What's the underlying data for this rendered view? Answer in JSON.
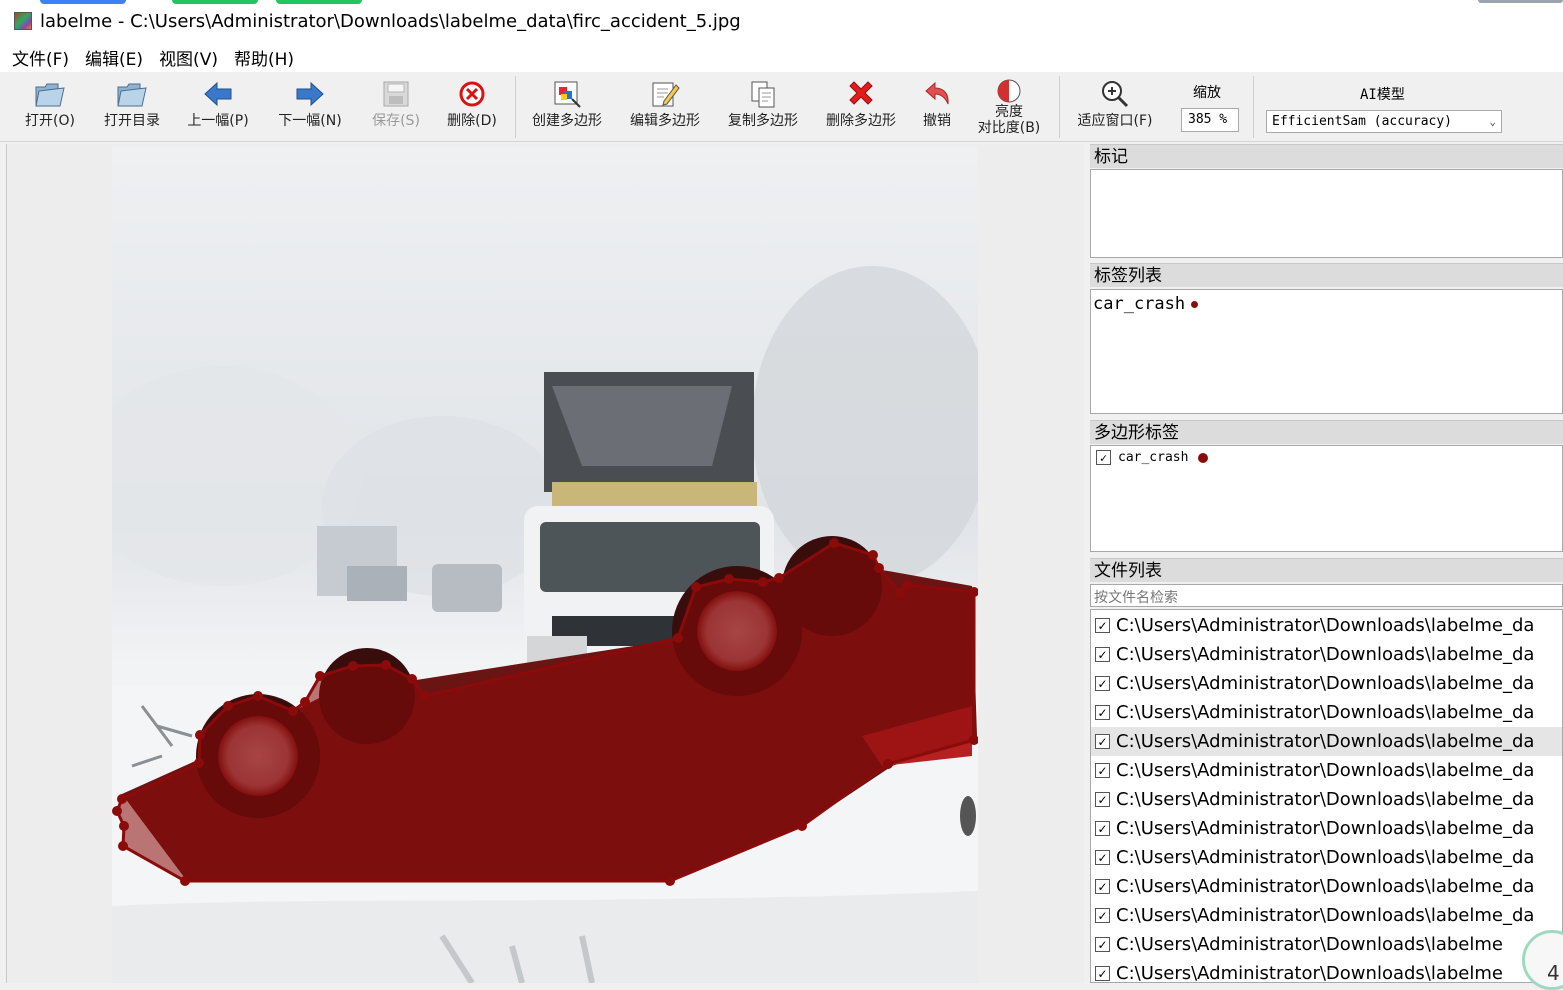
{
  "window": {
    "title": "labelme - C:\\Users\\Administrator\\Downloads\\labelme_data\\firc_accident_5.jpg"
  },
  "menu": [
    "文件(F)",
    "编辑(E)",
    "视图(V)",
    "帮助(H)"
  ],
  "toolbar": {
    "open": "打开(O)",
    "open_dir": "打开目录",
    "prev": "上一幅(P)",
    "next": "下一幅(N)",
    "save": "保存(S)",
    "delete": "删除(D)",
    "create_polygon": "创建多边形",
    "edit_polygon": "编辑多边形",
    "copy_polygon": "复制多边形",
    "delete_polygon": "删除多边形",
    "undo": "撤销",
    "brightness_line1": "亮度",
    "brightness_line2": "对比度(B)",
    "fit_window": "适应窗口(F)",
    "zoom_label": "缩放",
    "zoom_value": "385 %",
    "ai_label": "AI模型",
    "ai_model": "EfficientSam (accuracy)"
  },
  "panels": {
    "flags_title": "标记",
    "label_list_title": "标签列表",
    "label_list": [
      {
        "label": "car_crash",
        "color": "#8b0a0a"
      }
    ],
    "polygon_labels_title": "多边形标签",
    "polygon_labels": [
      {
        "label": "car_crash",
        "checked": true,
        "color": "#8b0a0a"
      }
    ],
    "file_list_title": "文件列表",
    "search_placeholder": "按文件名检索",
    "files": [
      {
        "path": "C:\\Users\\Administrator\\Downloads\\labelme_da",
        "checked": true,
        "selected": false
      },
      {
        "path": "C:\\Users\\Administrator\\Downloads\\labelme_da",
        "checked": true,
        "selected": false
      },
      {
        "path": "C:\\Users\\Administrator\\Downloads\\labelme_da",
        "checked": true,
        "selected": false
      },
      {
        "path": "C:\\Users\\Administrator\\Downloads\\labelme_da",
        "checked": true,
        "selected": false
      },
      {
        "path": "C:\\Users\\Administrator\\Downloads\\labelme_da",
        "checked": true,
        "selected": true
      },
      {
        "path": "C:\\Users\\Administrator\\Downloads\\labelme_da",
        "checked": true,
        "selected": false
      },
      {
        "path": "C:\\Users\\Administrator\\Downloads\\labelme_da",
        "checked": true,
        "selected": false
      },
      {
        "path": "C:\\Users\\Administrator\\Downloads\\labelme_da",
        "checked": true,
        "selected": false
      },
      {
        "path": "C:\\Users\\Administrator\\Downloads\\labelme_da",
        "checked": true,
        "selected": false
      },
      {
        "path": "C:\\Users\\Administrator\\Downloads\\labelme_da",
        "checked": true,
        "selected": false
      },
      {
        "path": "C:\\Users\\Administrator\\Downloads\\labelme_da",
        "checked": true,
        "selected": false
      },
      {
        "path": "C:\\Users\\Administrator\\Downloads\\labelme",
        "checked": true,
        "selected": false
      },
      {
        "path": "C:\\Users\\Administrator\\Downloads\\labelme",
        "checked": true,
        "selected": false
      }
    ]
  },
  "corner_badge": "4",
  "colors": {
    "polygon": "#8b0a0a",
    "polygon_fill": "rgba(139,10,10,0.78)"
  }
}
